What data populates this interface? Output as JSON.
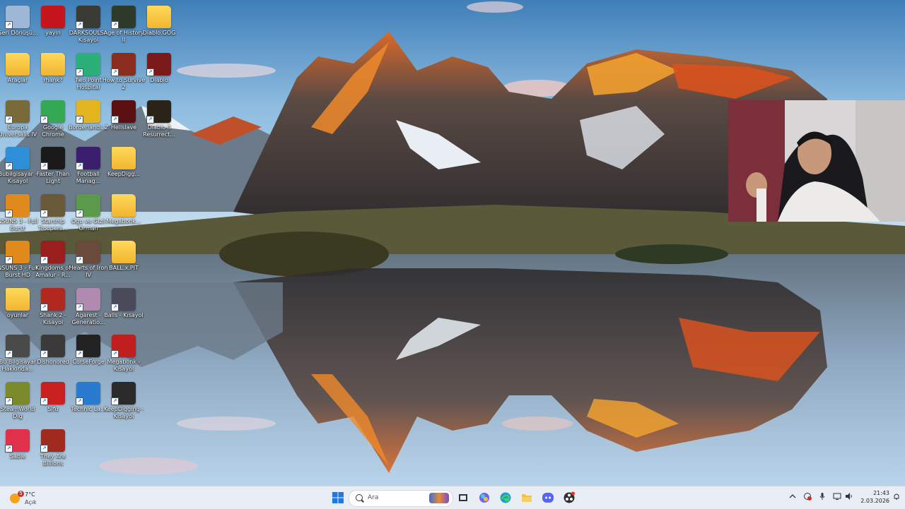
{
  "desktop": {
    "icons": [
      {
        "label": "Geri Dönüşü...",
        "icon": "recycle-bin-icon",
        "color": "#9fb7d6"
      },
      {
        "label": "yayin",
        "icon": "flag-folder-icon",
        "color": "#c4161c"
      },
      {
        "label": "DARKSOULS - Kısayol",
        "icon": "dark-souls-icon",
        "color": "#3b3b35"
      },
      {
        "label": "Age of History II",
        "icon": "age-of-history-icon",
        "color": "#2e3a2a"
      },
      {
        "label": "Diablo.GOG",
        "icon": "folder-icon",
        "color": "#f2c14b"
      },
      {
        "label": "Araçlar",
        "icon": "folder-icon",
        "color": "#f2c14b"
      },
      {
        "label": "rhank?",
        "icon": "folder-icon",
        "color": "#f2c14b"
      },
      {
        "label": "Two Point Hospital",
        "icon": "two-point-hospital-icon",
        "color": "#2bb07a"
      },
      {
        "label": "How to Survive 2",
        "icon": "how-to-survive-icon",
        "color": "#8a2d1e"
      },
      {
        "label": "Diablo",
        "icon": "diablo-icon",
        "color": "#7a1a1a"
      },
      {
        "label": "Europa Universalis IV",
        "icon": "europa-universalis-icon",
        "color": "#7a6a3a"
      },
      {
        "label": "Google Chrome",
        "icon": "chrome-icon",
        "color": "#34a853"
      },
      {
        "label": "Borderlands 2",
        "icon": "borderlands-icon",
        "color": "#e2b51e"
      },
      {
        "label": "Hellslave",
        "icon": "hellslave-icon",
        "color": "#5a1010"
      },
      {
        "label": "Diablo II Resurrect...",
        "icon": "diablo-2-icon",
        "color": "#2a2418"
      },
      {
        "label": "Bubilgisayar - Kısayol",
        "icon": "this-pc-icon",
        "color": "#2f8fd6"
      },
      {
        "label": "Faster Than Light",
        "icon": "ftl-icon",
        "color": "#1a1a1a"
      },
      {
        "label": "Football Manag...",
        "icon": "football-manager-icon",
        "color": "#3b1f6e"
      },
      {
        "label": "KeepDigg...",
        "icon": "folder-icon",
        "color": "#f2c14b"
      },
      {
        "label": "NSUNS 3 - Full Burst",
        "icon": "naruto-icon",
        "color": "#e08a1e"
      },
      {
        "label": "Starship Troopers...",
        "icon": "starship-troopers-icon",
        "color": "#6a5a3a"
      },
      {
        "label": "Ogu ve Gizli Orman",
        "icon": "ogu-icon",
        "color": "#5a9a4a"
      },
      {
        "label": "Megabonk...",
        "icon": "folder-icon",
        "color": "#f2c14b"
      },
      {
        "label": "NSUNS 3 - Full Burst HD",
        "icon": "naruto-hd-icon",
        "color": "#e08a1e"
      },
      {
        "label": "Kingdoms of Amalur - R...",
        "icon": "amalur-icon",
        "color": "#9a1e1e"
      },
      {
        "label": "Hearts of Iron IV",
        "icon": "hearts-of-iron-icon",
        "color": "#6a4a3a"
      },
      {
        "label": "BALL.x.PIT",
        "icon": "folder-icon",
        "color": "#f2c14b"
      },
      {
        "label": "oyunlar",
        "icon": "folder-icon",
        "color": "#f2c14b"
      },
      {
        "label": "Shank 2 - Kısayol",
        "icon": "shank-icon",
        "color": "#b0281e"
      },
      {
        "label": "Agarest - Generatio...",
        "icon": "agarest-icon",
        "color": "#b08ab0"
      },
      {
        "label": "Balls - Kısayol",
        "icon": "balls-icon",
        "color": "#4a4a5a"
      },
      {
        "label": "Bu Bilgisayar Hakkında...",
        "icon": "about-pc-icon",
        "color": "#4a4a4a"
      },
      {
        "label": "Dishonored",
        "icon": "dishonored-icon",
        "color": "#3a3a3a"
      },
      {
        "label": "CurseForge",
        "icon": "curseforge-icon",
        "color": "#222222"
      },
      {
        "label": "Megabonk - Kısayol",
        "icon": "megabonk-icon",
        "color": "#c01e1e"
      },
      {
        "label": "SteamWorld Dig",
        "icon": "steamworld-icon",
        "color": "#7a8a2a"
      },
      {
        "label": "Sifu",
        "icon": "sifu-icon",
        "color": "#c8201e"
      },
      {
        "label": "Technic La...",
        "icon": "technic-launcher-icon",
        "color": "#2a7ad0"
      },
      {
        "label": "KeepDigging - Kısayol",
        "icon": "keep-digging-icon",
        "color": "#2a2a2a"
      },
      {
        "label": "Sable",
        "icon": "sable-icon",
        "color": "#e0304a"
      },
      {
        "label": "They Are Billions",
        "icon": "they-are-billions-icon",
        "color": "#a02a1e"
      }
    ]
  },
  "taskbar": {
    "weather_temp": "7°C",
    "weather_condition": "Açık",
    "weather_badge": "5",
    "search_placeholder": "Ara",
    "clock_time": "21:43",
    "clock_date": "2.03.2026",
    "pinned": [
      {
        "icon": "start-windows-icon",
        "color": "#1f7ae0"
      },
      {
        "icon": "task-view-icon",
        "color": "#333333"
      },
      {
        "icon": "copilot-icon",
        "color": "#7a5cf0"
      },
      {
        "icon": "edge-icon",
        "color": "#1ba1c9"
      },
      {
        "icon": "file-explorer-icon",
        "color": "#f2c14b"
      },
      {
        "icon": "discord-icon",
        "color": "#5865f2"
      },
      {
        "icon": "obs-icon",
        "color": "#302e31"
      }
    ]
  }
}
